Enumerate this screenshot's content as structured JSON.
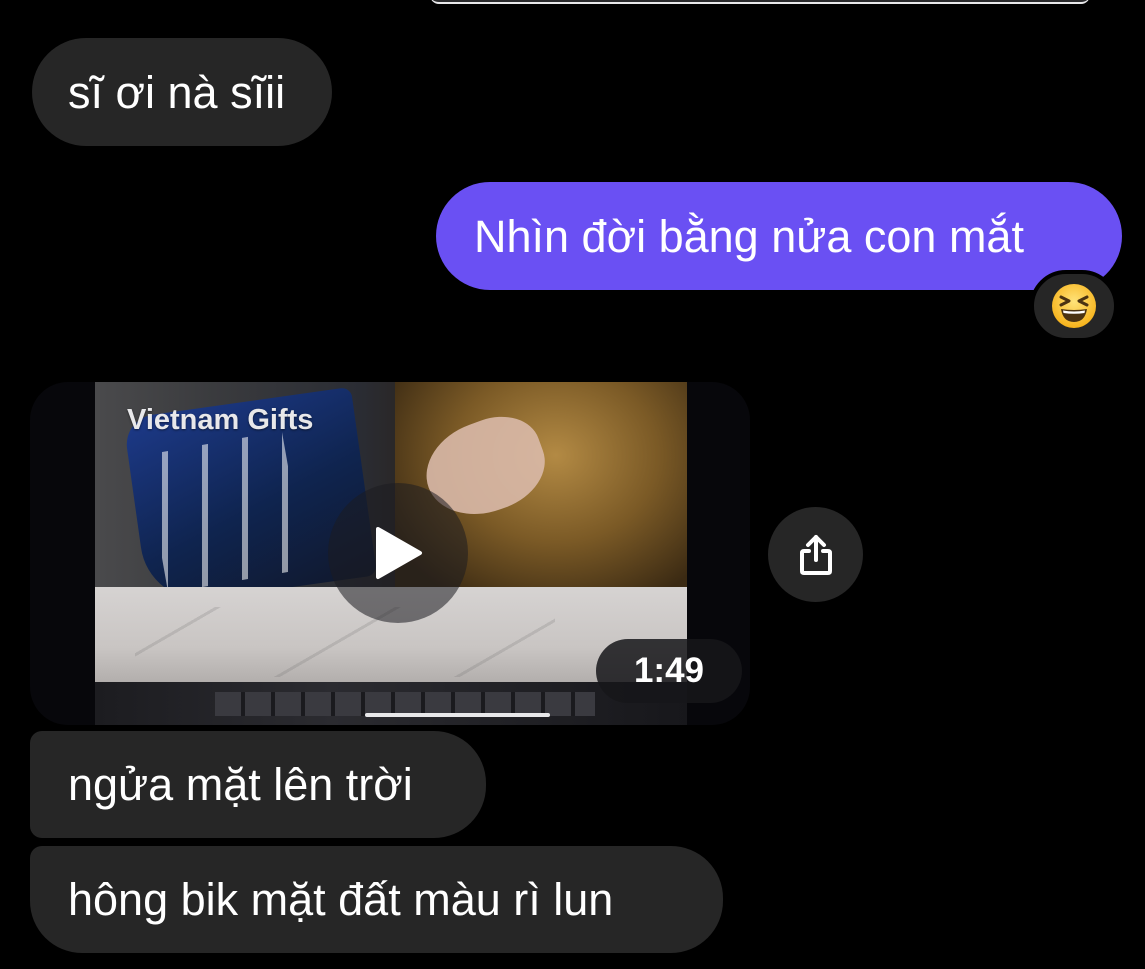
{
  "messages": [
    {
      "direction": "incoming",
      "text": "sĩ ơi nà sĩii"
    },
    {
      "direction": "outgoing",
      "text": "Nhìn đời bằng nửa con mắt",
      "reaction": "😆"
    },
    {
      "direction": "incoming",
      "type": "video",
      "watermark": "Vietnam Gifts",
      "duration": "1:49"
    },
    {
      "direction": "incoming",
      "text": "ngửa mặt lên trời"
    },
    {
      "direction": "incoming",
      "text": "hông bik mặt đất màu rì lun"
    }
  ],
  "icons": {
    "play": "play-icon",
    "share": "share-icon"
  },
  "colors": {
    "background": "#000000",
    "incoming_bubble": "#262626",
    "outgoing_bubble": "#6a50f3",
    "text": "#ffffff"
  }
}
